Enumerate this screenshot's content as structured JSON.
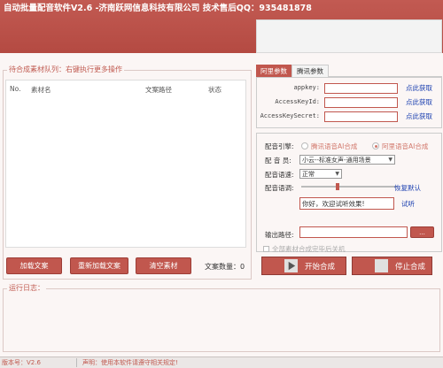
{
  "window": {
    "title": "自动批量配音软件V2.6 -济南跃网信息科技有限公司 技术售后QQ：935481878"
  },
  "left_panel": {
    "legend": "待合成素材队列：右键执行更多操作",
    "columns": [
      "No.",
      "素材名",
      "文案路径",
      "状态"
    ],
    "buttons": {
      "load": "加载文案",
      "reload": "重新加载文案",
      "clear": "清空素材"
    },
    "count_label": "文案数量：",
    "count_value": "0"
  },
  "tabs": [
    "阿里参数",
    "腾讯参数"
  ],
  "aliyun": {
    "fields": [
      {
        "label": "appkey:",
        "value": "",
        "link": "点此获取"
      },
      {
        "label": "AccessKeyId:",
        "value": "",
        "link": "点此获取"
      },
      {
        "label": "AccessKeySecret:",
        "value": "",
        "link": "点此获取"
      }
    ]
  },
  "settings": {
    "engine_label": "配音引擎:",
    "engine_options": [
      {
        "label": "腾讯语音AI合成",
        "selected": false
      },
      {
        "label": "阿里语音AI合成",
        "selected": true
      }
    ],
    "voice_label": "配 音 员:",
    "voice_value": "小云--标准女声-通用场景",
    "speed_label": "配音语速:",
    "speed_value": "正常",
    "volume_label": "配音语调:",
    "volume_level": 0.38,
    "restore_link": "恢复默认",
    "preview_text": "你好，欢迎试听效果!",
    "listen_link": "试听"
  },
  "output": {
    "label": "输出路径:",
    "value": "",
    "browse": "..."
  },
  "shutdown_option": {
    "label": "全部素材合成完毕后关机",
    "checked": false
  },
  "actions": {
    "start": "开始合成",
    "stop": "停止合成"
  },
  "log": {
    "legend": "运行日志："
  },
  "status_bar": {
    "version": "版本号：V2.6",
    "notice": "声明：使用本软件请遵守相关规定!"
  },
  "colors": {
    "primary": "#c1574e",
    "header": "#b44a42",
    "link": "#1a3fb0",
    "radio_text": "#d2786c"
  }
}
